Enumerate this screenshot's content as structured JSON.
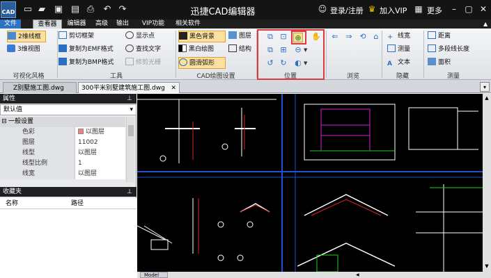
{
  "app": {
    "logo_text": "CAD",
    "title": "迅捷CAD编辑器",
    "login": "登录/注册",
    "vip": "加入VIP",
    "more": "更多"
  },
  "menu_tabs": [
    "文件",
    "查看器",
    "编辑器",
    "高级",
    "输出",
    "VIP功能",
    "相关软件"
  ],
  "ribbon": {
    "visual_style": {
      "items": [
        "2维线框",
        "3维视图"
      ],
      "label": "可视化风格"
    },
    "tools": {
      "items": [
        "剪切框架",
        "复制为EMF格式",
        "复制为BMP格式",
        "显示点",
        "查找文字",
        "修剪光栅"
      ],
      "label": "工具"
    },
    "cad_settings": {
      "items": [
        "黑色背景",
        "黑白绘图",
        "圆滑弧形",
        "图层",
        "结构"
      ],
      "label": "CAD绘图设置"
    },
    "position": {
      "label": "位置"
    },
    "browse": {
      "label": "浏览"
    },
    "hidden": {
      "items": [
        "线宽",
        "测量",
        "文本"
      ],
      "label": "隐藏"
    },
    "measure": {
      "items": [
        "距离",
        "多段线长度",
        "面积"
      ],
      "label": "测量"
    }
  },
  "doc_tabs": [
    "Z别墅施工图.dwg",
    "300平米别墅建筑施工图.dwg"
  ],
  "properties": {
    "header": "属性",
    "default_value": "默认值",
    "section": "一般设置",
    "rows": [
      {
        "label": "色彩",
        "value": "以图层"
      },
      {
        "label": "图层",
        "value": "11002"
      },
      {
        "label": "线型",
        "value": "以图层"
      },
      {
        "label": "线型比例",
        "value": "1"
      },
      {
        "label": "线宽",
        "value": "以图层"
      }
    ]
  },
  "favorites": {
    "header": "收藏夹",
    "col_name": "名称",
    "col_path": "路径"
  },
  "layout_tab": "Model",
  "colors": {
    "accent_blue": "#2d72c4",
    "highlight_red": "#e0383c",
    "canvas_bg": "#000000",
    "panel_dark": "#1f2024"
  }
}
